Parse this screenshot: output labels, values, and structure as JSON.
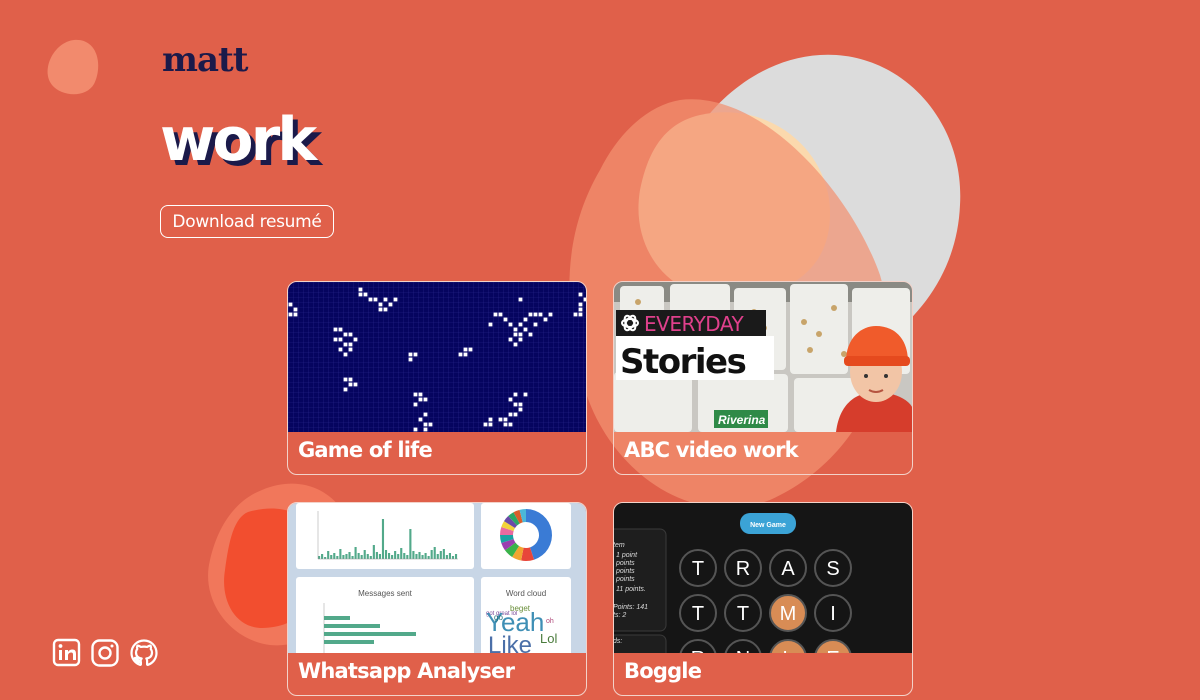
{
  "logo": "matt",
  "page_heading": "work",
  "resume_button": "Download resumé",
  "colors": {
    "background": "#e0604a",
    "text": "#ffffff",
    "accent_dark": "#1b1a4a"
  },
  "projects": [
    {
      "title": "Game of life"
    },
    {
      "title": "ABC video work",
      "thumb": {
        "brand": "EVERYDAY",
        "headline": "Stories",
        "bucket_label": "Riverina"
      }
    },
    {
      "title": "Whatsapp Analyser",
      "thumb": {
        "chart_title": "Messages sent",
        "cloud_title": "Word cloud",
        "cloud_words": [
          "Yeah",
          "Like",
          "Lol"
        ]
      }
    },
    {
      "title": "Boggle",
      "thumb": {
        "new_game": "New Game",
        "score_lines": [
          "tem",
          "1 point",
          "points",
          "points",
          "points",
          "11 points.",
          "Points: 141",
          "ts: 2",
          "ds:"
        ],
        "rows": [
          [
            "T",
            "R",
            "A",
            "S"
          ],
          [
            "T",
            "T",
            "M",
            "I"
          ],
          [
            "R",
            "N",
            "L",
            "E"
          ]
        ],
        "highlighted": [
          [
            1,
            2
          ],
          [
            2,
            2
          ],
          [
            2,
            3
          ]
        ]
      }
    }
  ],
  "social": [
    {
      "name": "linkedin-icon"
    },
    {
      "name": "instagram-icon"
    },
    {
      "name": "github-icon"
    }
  ]
}
